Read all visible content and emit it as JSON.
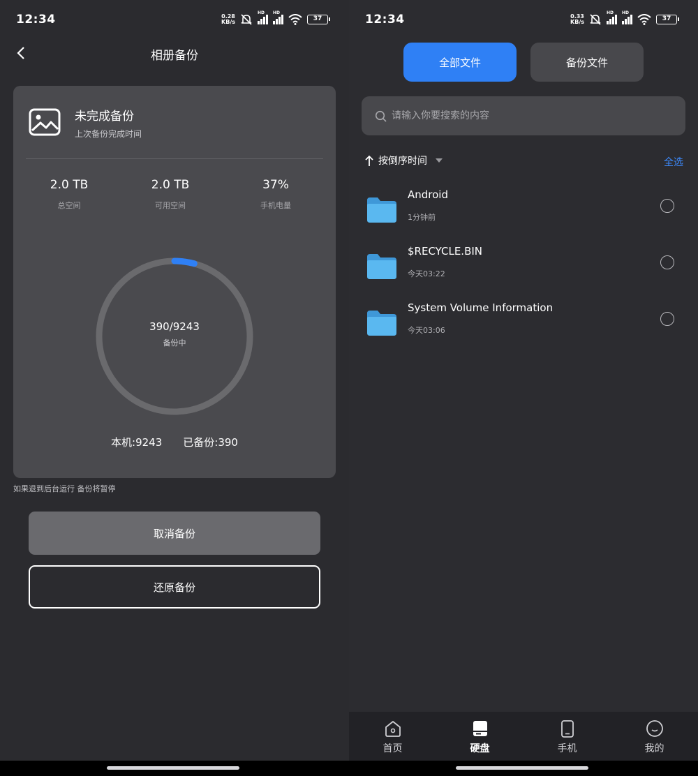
{
  "left": {
    "status": {
      "time": "12:34",
      "net_speed": "0.28",
      "net_unit": "KB/s",
      "hd1": "HD",
      "hd2": "HD",
      "battery": "37"
    },
    "title": "相册备份",
    "card": {
      "title": "未完成备份",
      "subtitle": "上次备份完成时间",
      "stats": [
        {
          "value": "2.0 TB",
          "label": "总空间"
        },
        {
          "value": "2.0 TB",
          "label": "可用空间"
        },
        {
          "value": "37%",
          "label": "手机电量"
        }
      ],
      "progress": {
        "text": "390/9243",
        "state": "备份中",
        "done": 390,
        "total": 9243
      },
      "local_count": "本机:9243",
      "backed_count": "已备份:390"
    },
    "hint": "如果退到后台运行 备份将暂停",
    "cancel_label": "取消备份",
    "restore_label": "还原备份",
    "colors": {
      "accent": "#2f80f5",
      "card": "#4a4a4e",
      "ring_track": "#666669"
    }
  },
  "right": {
    "status": {
      "time": "12:34",
      "net_speed": "0.33",
      "net_unit": "KB/s",
      "hd1": "HD",
      "hd2": "HD",
      "battery": "37"
    },
    "segments": {
      "all": "全部文件",
      "backup": "备份文件"
    },
    "search_placeholder": "请输入你要搜索的内容",
    "sort_label": "按倒序时间",
    "select_all": "全选",
    "files": [
      {
        "name": "Android",
        "time": "1分钟前",
        "icon": "folder-icon"
      },
      {
        "name": "$RECYCLE.BIN",
        "time": "今天03:22",
        "icon": "folder-icon"
      },
      {
        "name": "System Volume Information",
        "time": "今天03:06",
        "icon": "folder-icon"
      }
    ],
    "tabs": [
      {
        "label": "首页",
        "icon": "home-icon"
      },
      {
        "label": "硬盘",
        "icon": "disk-icon",
        "active": true
      },
      {
        "label": "手机",
        "icon": "phone-icon"
      },
      {
        "label": "我的",
        "icon": "profile-icon"
      }
    ],
    "colors": {
      "select_all": "#3d8bff",
      "folder": "#5ab8f0"
    }
  }
}
